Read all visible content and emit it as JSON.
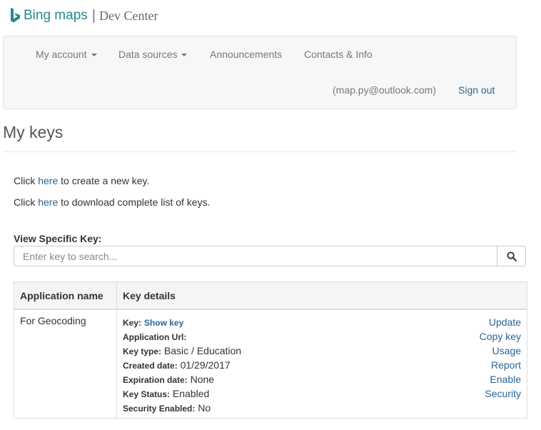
{
  "logo": {
    "brand": "Bing maps",
    "separator": "|",
    "dev": "Dev Center",
    "icon": "bing-logo-icon",
    "brand_color": "#258a8c"
  },
  "nav": {
    "my_account": "My account",
    "data_sources": "Data sources",
    "announcements": "Announcements",
    "contacts": "Contacts & Info",
    "email": "(map.py@outlook.com)",
    "sign_out": "Sign out"
  },
  "page": {
    "title": "My keys"
  },
  "create": {
    "prefix": "Click",
    "link": "here",
    "suffix": "to create a new key."
  },
  "download": {
    "prefix": "Click",
    "link": "here",
    "suffix": "to download complete list of keys."
  },
  "search": {
    "label": "View Specific Key:",
    "placeholder": "Enter key to search...",
    "icon": "search-icon"
  },
  "table": {
    "headers": [
      "Application name",
      "Key details"
    ],
    "row": {
      "app_name": "For Geocoding",
      "key_label": "Key:",
      "key_link": "Show key",
      "app_url_label": "Application Url:",
      "app_url_value": "",
      "key_type_label": "Key type:",
      "key_type_value": "Basic / Education",
      "created_label": "Created date:",
      "created_value": "01/29/2017",
      "expiration_label": "Expiration date:",
      "expiration_value": "None",
      "status_label": "Key Status:",
      "status_value": "Enabled",
      "security_label": "Security Enabled:",
      "security_value": "No",
      "actions": [
        "Update",
        "Copy key",
        "Usage",
        "Report",
        "Enable",
        "Security"
      ]
    }
  },
  "colors": {
    "link": "#2a6496",
    "nav_text": "#777777",
    "navbar_bg": "#f7f7f7"
  }
}
